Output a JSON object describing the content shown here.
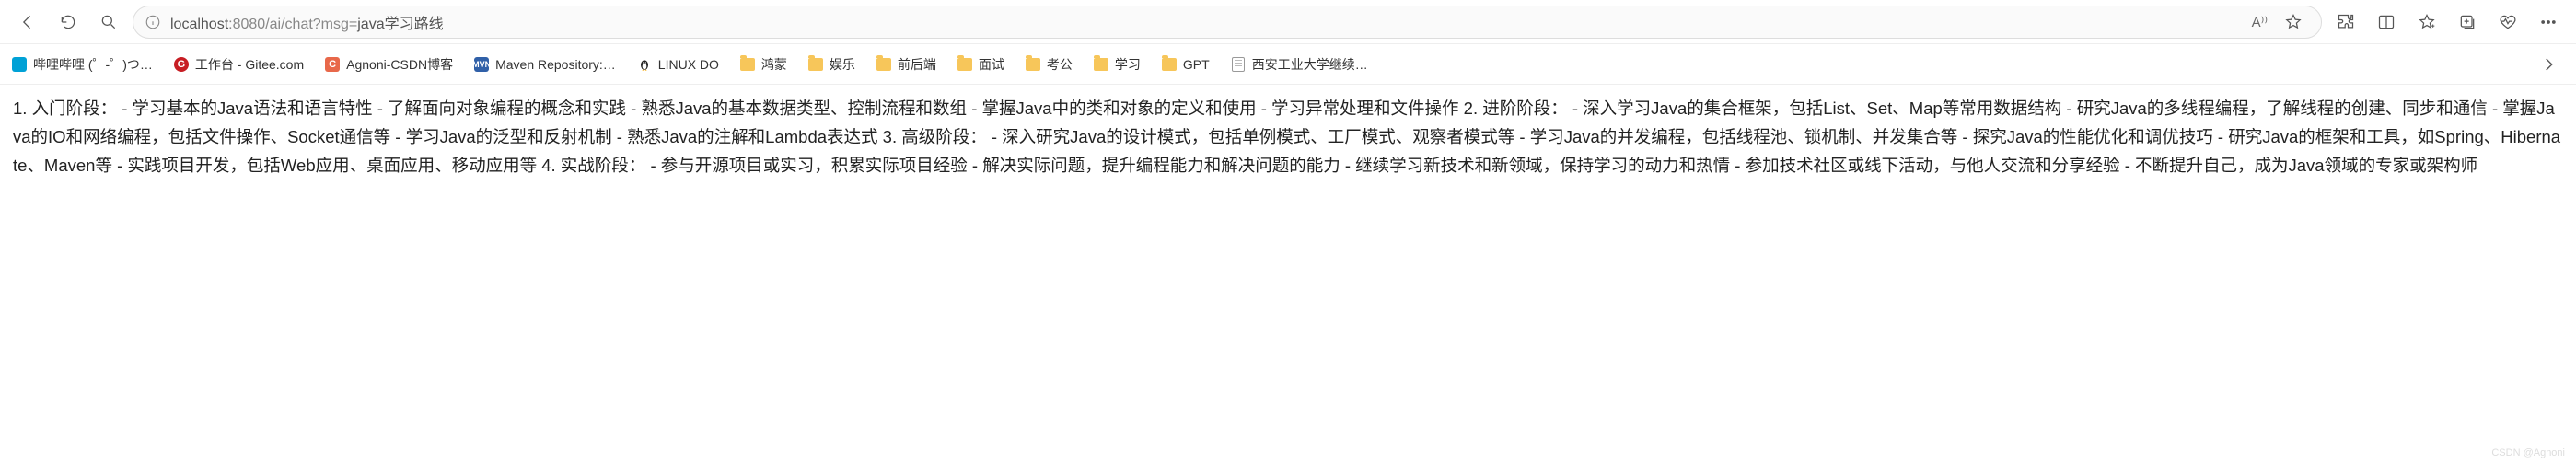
{
  "address": {
    "host": "localhost",
    "port_path": ":8080/ai/chat?msg=",
    "query": "java学习路线"
  },
  "toolbar_icons": {
    "read_aloud": "A⁾⁾"
  },
  "bookmarks": [
    {
      "id": "bilibili",
      "label": "哔哩哔哩 (゜-゜)つ…",
      "kind": "sq-b",
      "letter": ""
    },
    {
      "id": "gitee",
      "label": "工作台 - Gitee.com",
      "kind": "sq-r",
      "letter": "G"
    },
    {
      "id": "csdn",
      "label": "Agnoni-CSDN博客",
      "kind": "sq-o",
      "letter": "C"
    },
    {
      "id": "maven",
      "label": "Maven Repository:…",
      "kind": "sq-blue",
      "letter": "MVN"
    },
    {
      "id": "linuxdo",
      "label": "LINUX DO",
      "kind": "penguin",
      "letter": ""
    },
    {
      "id": "hongmeng",
      "label": "鸿蒙",
      "kind": "folder"
    },
    {
      "id": "yule",
      "label": "娱乐",
      "kind": "folder"
    },
    {
      "id": "qianhou",
      "label": "前后端",
      "kind": "folder"
    },
    {
      "id": "mianshi",
      "label": "面试",
      "kind": "folder"
    },
    {
      "id": "kaogong",
      "label": "考公",
      "kind": "folder"
    },
    {
      "id": "xuexi",
      "label": "学习",
      "kind": "folder"
    },
    {
      "id": "gpt",
      "label": "GPT",
      "kind": "folder"
    },
    {
      "id": "xatu",
      "label": "西安工业大学继续…",
      "kind": "page"
    }
  ],
  "content_text": "1. 入门阶段：  - 学习基本的Java语法和语言特性  - 了解面向对象编程的概念和实践 - 熟悉Java的基本数据类型、控制流程和数组 - 掌握Java中的类和对象的定义和使用 - 学习异常处理和文件操作 2. 进阶阶段：  - 深入学习Java的集合框架，包括List、Set、Map等常用数据结构 - 研究Java的多线程编程，了解线程的创建、同步和通信 - 掌握Java的IO和网络编程，包括文件操作、Socket通信等 - 学习Java的泛型和反射机制 - 熟悉Java的注解和Lambda表达式 3. 高级阶段：  - 深入研究Java的设计模式，包括单例模式、工厂模式、观察者模式等 - 学习Java的并发编程，包括线程池、锁机制、并发集合等 - 探究Java的性能优化和调优技巧 - 研究Java的框架和工具，如Spring、Hibernate、Maven等 - 实践项目开发，包括Web应用、桌面应用、移动应用等 4. 实战阶段：  - 参与开源项目或实习，积累实际项目经验 - 解决实际问题，提升编程能力和解决问题的能力 - 继续学习新技术和新领域，保持学习的动力和热情 - 参加技术社区或线下活动，与他人交流和分享经验 - 不断提升自己，成为Java领域的专家或架构师",
  "watermark": "CSDN @Agnoni"
}
